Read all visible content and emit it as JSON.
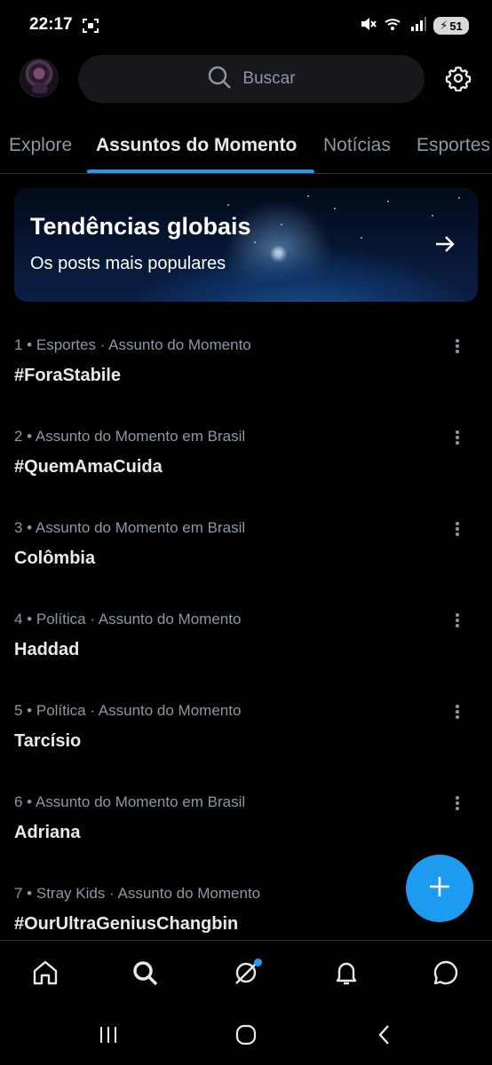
{
  "status": {
    "time": "22:17",
    "battery": "51"
  },
  "search": {
    "placeholder": "Buscar"
  },
  "tabs": [
    {
      "label": "Explore"
    },
    {
      "label": "Assuntos do Momento"
    },
    {
      "label": "Notícias"
    },
    {
      "label": "Esportes"
    }
  ],
  "banner": {
    "title": "Tendências globais",
    "subtitle": "Os posts mais populares"
  },
  "trends": [
    {
      "meta": "1 • Esportes · Assunto do Momento",
      "name": "#ForaStabile"
    },
    {
      "meta": "2 • Assunto do Momento em Brasil",
      "name": "#QuemAmaCuida"
    },
    {
      "meta": "3 • Assunto do Momento em Brasil",
      "name": "Colômbia"
    },
    {
      "meta": "4 • Política · Assunto do Momento",
      "name": "Haddad"
    },
    {
      "meta": "5 • Política · Assunto do Momento",
      "name": "Tarcísio"
    },
    {
      "meta": "6 • Assunto do Momento em Brasil",
      "name": "Adriana"
    },
    {
      "meta": "7 • Stray Kids · Assunto do Momento",
      "name": "#OurUltraGeniusChangbin"
    }
  ],
  "colors": {
    "accent": "#1d9bf0",
    "background": "#000000",
    "text_primary": "#e7e9ea",
    "text_secondary": "#8b98a5"
  },
  "icons": {
    "top": [
      "avatar",
      "search-icon",
      "gear-icon"
    ],
    "bottom_nav": [
      "home-icon",
      "search-icon",
      "grok-icon",
      "bell-icon",
      "message-icon"
    ],
    "system_nav": [
      "recents-icon",
      "home-circle-icon",
      "back-icon"
    ]
  }
}
